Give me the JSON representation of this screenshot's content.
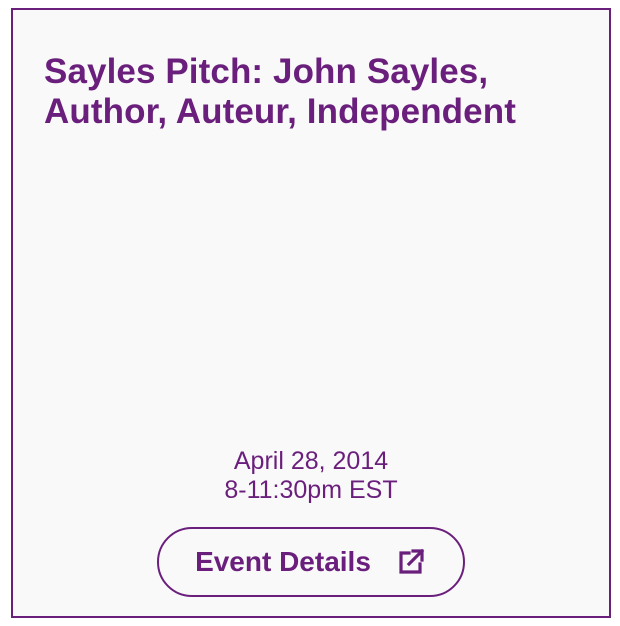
{
  "event": {
    "title": "Sayles Pitch: John Sayles, Author, Auteur, Independent",
    "date": "April 28, 2014",
    "time": "8-11:30pm EST"
  },
  "actions": {
    "details_label": "Event Details",
    "details_icon": "external-link-icon"
  },
  "colors": {
    "accent": "#6b1f7c",
    "card_background": "#f9f9f9"
  }
}
